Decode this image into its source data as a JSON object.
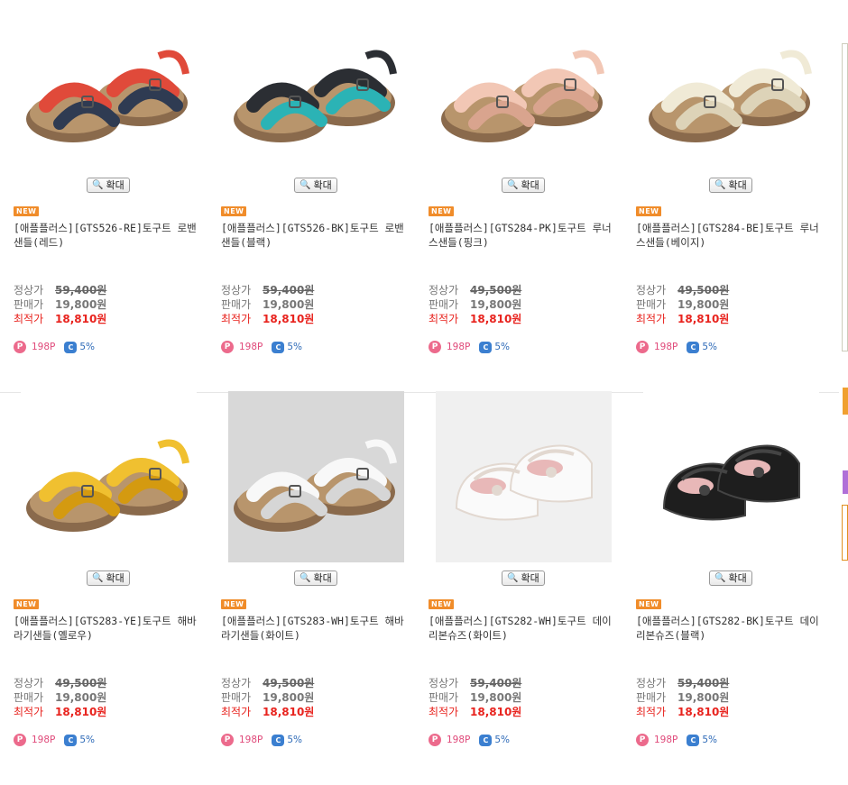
{
  "zoom_label": "확대",
  "new_label": "NEW",
  "price_labels": {
    "list": "정상가",
    "sale": "판매가",
    "best": "최적가"
  },
  "products": [
    {
      "title": "[애플플러스][GTS526-RE]토구트 로밴샌들(레드)",
      "list_price": "59,400원",
      "sale_price": "19,800원",
      "best_price": "18,810원",
      "points": "198P",
      "coupon": "5%",
      "colors": [
        "#e04a3a",
        "#2f3b52"
      ]
    },
    {
      "title": "[애플플러스][GTS526-BK]토구트 로밴샌들(블랙)",
      "list_price": "59,400원",
      "sale_price": "19,800원",
      "best_price": "18,810원",
      "points": "198P",
      "coupon": "5%",
      "colors": [
        "#2b2e33",
        "#2bb3b5"
      ]
    },
    {
      "title": "[애플플러스][GTS284-PK]토구트 루너스샌들(핑크)",
      "list_price": "49,500원",
      "sale_price": "19,800원",
      "best_price": "18,810원",
      "points": "198P",
      "coupon": "5%",
      "colors": [
        "#f2c7b5",
        "#d9a48e"
      ]
    },
    {
      "title": "[애플플러스][GTS284-BE]토구트 루너스샌들(베이지)",
      "list_price": "49,500원",
      "sale_price": "19,800원",
      "best_price": "18,810원",
      "points": "198P",
      "coupon": "5%",
      "colors": [
        "#f0ead6",
        "#ddd3b8"
      ]
    },
    {
      "title": "[애플플러스][GTS283-YE]토구트 해바라기샌들(옐로우)",
      "list_price": "49,500원",
      "sale_price": "19,800원",
      "best_price": "18,810원",
      "points": "198P",
      "coupon": "5%",
      "colors": [
        "#f0c030",
        "#d49a10"
      ]
    },
    {
      "title": "[애플플러스][GTS283-WH]토구트 해바라기샌들(화이트)",
      "list_price": "49,500원",
      "sale_price": "19,800원",
      "best_price": "18,810원",
      "points": "198P",
      "coupon": "5%",
      "colors": [
        "#f8f8f8",
        "#d6d6d6"
      ]
    },
    {
      "title": "[애플플러스][GTS282-WH]토구트 데이리본슈즈(화이트)",
      "list_price": "59,400원",
      "sale_price": "19,800원",
      "best_price": "18,810원",
      "points": "198P",
      "coupon": "5%",
      "colors": [
        "#fafafa",
        "#e2d8d0"
      ]
    },
    {
      "title": "[애플플러스][GTS282-BK]토구트 데이리본슈즈(블랙)",
      "list_price": "59,400원",
      "sale_price": "19,800원",
      "best_price": "18,810원",
      "points": "198P",
      "coupon": "5%",
      "colors": [
        "#1e1e1e",
        "#444444"
      ]
    }
  ],
  "sidebar_colors": [
    "#c9b7a6",
    "#f0a030",
    "#b070d8",
    "#e0e0e0"
  ]
}
